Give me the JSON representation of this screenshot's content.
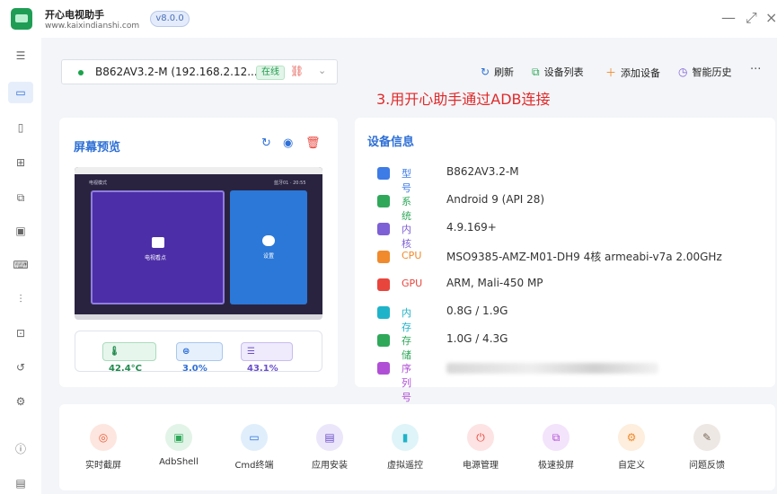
{
  "app": {
    "name": "开心电视助手",
    "url": "www.kaixindianshi.com",
    "version": "v8.0.0"
  },
  "window_controls": {
    "minimize": "—",
    "maximize": "⤢",
    "close": "×"
  },
  "sidebar": {
    "menu_icon": "menu-icon",
    "items": [
      {
        "icon": "monitor-icon",
        "active": true
      },
      {
        "icon": "phone-icon"
      },
      {
        "icon": "apps-icon"
      },
      {
        "icon": "cast-icon"
      },
      {
        "icon": "image-icon"
      },
      {
        "icon": "laptop-icon"
      },
      {
        "icon": "sliders-icon"
      },
      {
        "icon": "terminal-icon"
      },
      {
        "icon": "history-icon"
      },
      {
        "icon": "settings-icon"
      },
      {
        "icon": "info-icon"
      },
      {
        "icon": "document-icon"
      }
    ]
  },
  "device_selector": {
    "device": "B862AV3.2-M (192.168.2.12...",
    "status": "在线"
  },
  "toolbar": {
    "refresh": "刷新",
    "device_list": "设备列表",
    "add_device": "添加设备",
    "smart_history": "智能历史",
    "more": "···"
  },
  "annotation": "3.用开心助手通过ADB连接",
  "preview": {
    "title": "屏幕预览",
    "screen": {
      "top_left_label": "电视模式",
      "top_right_label": "蓝牙01 · 20:55",
      "tile_left_label": "电视看点",
      "tile_right_label": "设置"
    },
    "stats": {
      "temperature": "42.4°C",
      "cpu": "3.0%",
      "memory": "43.1%"
    }
  },
  "device_info": {
    "title": "设备信息",
    "rows": [
      {
        "label": "型号",
        "value": "B862AV3.2-M",
        "color": "#3d7be6",
        "icon": "tv-icon"
      },
      {
        "label": "系统",
        "value": "Android 9 (API 28)",
        "color": "#2fa85a",
        "icon": "android-icon"
      },
      {
        "label": "内核",
        "value": "4.9.169+",
        "color": "#7d5fd6",
        "icon": "layers-icon"
      },
      {
        "label": "CPU",
        "value": "MSO9385-AMZ-M01-DH9 4核 armeabi-v7a 2.00GHz",
        "color": "#f08a2c",
        "icon": "cpu-icon"
      },
      {
        "label": "GPU",
        "value": "ARM, Mali-450 MP",
        "color": "#e8453c",
        "icon": "gpu-icon"
      },
      {
        "label": "内存",
        "value": "0.8G / 1.9G",
        "color": "#1fb3c9",
        "icon": "memory-icon"
      },
      {
        "label": "存储",
        "value": "1.0G / 4.3G",
        "color": "#2fa85a",
        "icon": "storage-icon"
      },
      {
        "label": "序列号",
        "value": "",
        "color": "#b04fd6",
        "icon": "hash-icon"
      }
    ]
  },
  "tools": [
    {
      "label": "实时截屏",
      "bg": "#fde6df",
      "fg": "#e8613c",
      "icon": "camera-icon"
    },
    {
      "label": "AdbShell",
      "bg": "#e2f4e7",
      "fg": "#2fa85a",
      "icon": "shell-icon"
    },
    {
      "label": "Cmd终端",
      "bg": "#e0eefc",
      "fg": "#2d6fd6",
      "icon": "terminal-icon"
    },
    {
      "label": "应用安装",
      "bg": "#ece6fb",
      "fg": "#6a4fc9",
      "icon": "install-icon"
    },
    {
      "label": "虚拟遥控",
      "bg": "#dff4f8",
      "fg": "#1fb3c9",
      "icon": "remote-icon"
    },
    {
      "label": "电源管理",
      "bg": "#fde3e3",
      "fg": "#e8453c",
      "icon": "power-icon"
    },
    {
      "label": "极速投屏",
      "bg": "#f3e3fb",
      "fg": "#b04fd6",
      "icon": "cast-icon"
    },
    {
      "label": "自定义",
      "bg": "#fdeedd",
      "fg": "#f08a2c",
      "icon": "gear-icon"
    },
    {
      "label": "问题反馈",
      "bg": "#ede8e4",
      "fg": "#7a6a5c",
      "icon": "feedback-icon"
    }
  ]
}
